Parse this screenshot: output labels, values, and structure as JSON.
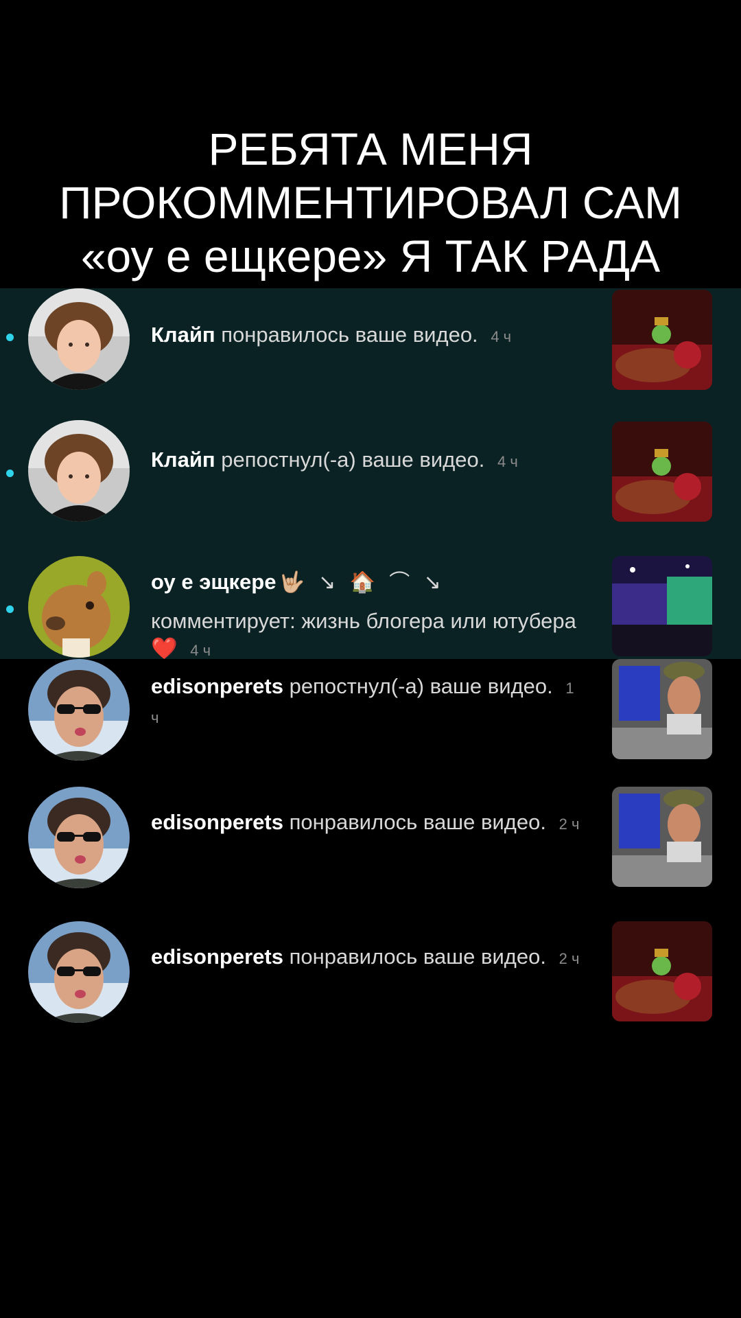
{
  "caption": {
    "line1": "РЕБЯТА МЕНЯ",
    "line2": "ПРОКОММЕНТИРОВАЛ САМ",
    "line3": "«оу е ещкере»  Я ТАК РАДА"
  },
  "notifications": [
    {
      "name": "Клайп",
      "action": "понравилось ваше видео.",
      "time": "4 ч",
      "unread": true,
      "avatar": "curly-hair-boy-avatar",
      "thumbnail": "red-game-thumbnail"
    },
    {
      "name": "Клайп",
      "action": "репостнул(-а) ваше видео.",
      "time": "4 ч",
      "unread": true,
      "avatar": "curly-hair-boy-avatar",
      "thumbnail": "red-game-thumbnail"
    },
    {
      "name": "оу е эщкере",
      "name_emoji": "🤟🏼 ↘ 🏠 ⌒ ↘",
      "action": "комментирует: жизнь блогера или ютубера ❤️",
      "time": "4 ч",
      "unread": true,
      "avatar": "capybara-avatar",
      "thumbnail": "night-game-thumbnail"
    },
    {
      "name": "edisonperets",
      "action": "репостнул(-а) ваше видео.",
      "time": "1 ч",
      "unread": false,
      "avatar": "sunglasses-man-avatar",
      "thumbnail": "streamer-thumbnail"
    },
    {
      "name": "edisonperets",
      "action": "понравилось ваше видео.",
      "time": "2 ч",
      "unread": false,
      "avatar": "sunglasses-man-avatar",
      "thumbnail": "streamer-thumbnail"
    },
    {
      "name": "edisonperets",
      "action": "понравилось ваше видео.",
      "time": "2 ч",
      "unread": false,
      "avatar": "sunglasses-man-avatar",
      "thumbnail": "red-game-thumbnail"
    }
  ],
  "colors": {
    "background": "#000000",
    "highlight_band": "#0a2224",
    "unread_dot": "#2fd4ea"
  }
}
